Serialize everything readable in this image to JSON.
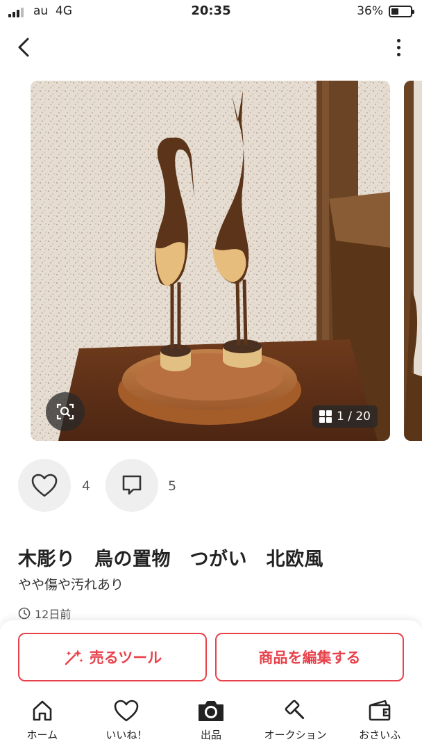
{
  "status_bar": {
    "carrier": "au  4G",
    "time": "20:35",
    "battery": "36%"
  },
  "header": {
    "back_icon": "chevron-left-icon",
    "menu_icon": "vertical-dots-icon"
  },
  "gallery": {
    "counter": "1 / 20",
    "zoom_icon": "image-search-icon"
  },
  "reactions": {
    "likes": "4",
    "comments": "5"
  },
  "item": {
    "title": "木彫り　鳥の置物　つがい　北欧風",
    "condition": "やや傷や汚れあり",
    "posted": "12日前"
  },
  "actions": {
    "sell_tool": "売るツール",
    "edit_item": "商品を編集する"
  },
  "tabs": [
    {
      "label": "ホーム",
      "icon": "home-icon"
    },
    {
      "label": "いいね！",
      "icon": "heart-icon"
    },
    {
      "label": "出品",
      "icon": "camera-icon"
    },
    {
      "label": "オークション",
      "icon": "gavel-icon"
    },
    {
      "label": "おさいふ",
      "icon": "wallet-icon"
    }
  ],
  "colors": {
    "accent": "#e8424b",
    "text": "#222222",
    "muted": "#555555",
    "reaction_bg": "#efefef"
  }
}
